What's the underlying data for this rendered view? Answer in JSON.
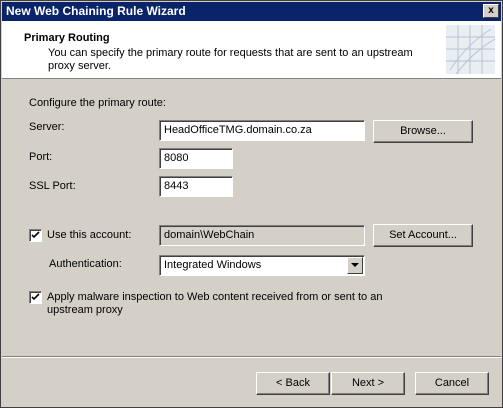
{
  "window": {
    "title": "New Web Chaining Rule Wizard",
    "close_label": "x"
  },
  "header": {
    "title": "Primary Routing",
    "description": "You can specify the primary route for requests that are sent to an upstream proxy server."
  },
  "form": {
    "section_label": "Configure the primary route:",
    "server": {
      "label": "Server:",
      "value": "HeadOfficeTMG.domain.co.za",
      "browse_label": "Browse..."
    },
    "port": {
      "label": "Port:",
      "value": "8080"
    },
    "ssl_port": {
      "label": "SSL Port:",
      "value": "8443"
    },
    "use_account": {
      "label": "Use this account:",
      "checked": true,
      "value": "domain\\WebChain",
      "set_account_label": "Set Account..."
    },
    "authentication": {
      "label": "Authentication:",
      "selected": "Integrated Windows"
    },
    "malware_inspection": {
      "label": "Apply malware inspection to Web content received from or sent to an upstream proxy",
      "checked": true
    }
  },
  "footer": {
    "back_label": "< Back",
    "next_label": "Next >",
    "cancel_label": "Cancel"
  },
  "icons": {
    "title_close": "close-icon",
    "header_graphic": "wizard-graphic-icon",
    "checkmark": "checkmark-icon",
    "dropdown": "chevron-down-icon"
  }
}
